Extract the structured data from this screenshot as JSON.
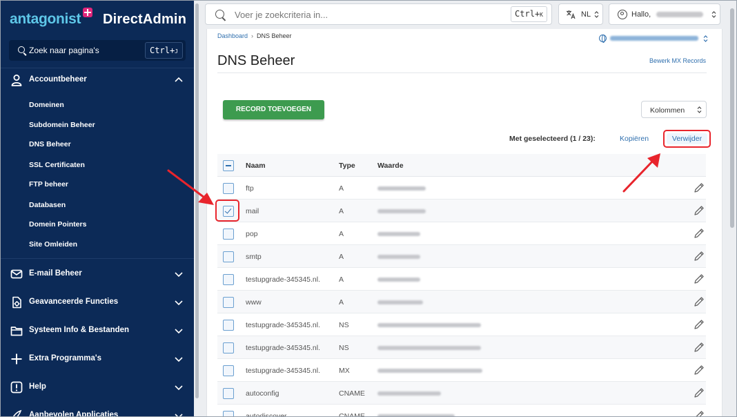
{
  "brand": {
    "logo_text": "antagonist",
    "product": "DirectAdmin"
  },
  "sidebar": {
    "search_placeholder": "Zoek naar pagina's",
    "search_shortcut": "Ctrl+",
    "search_shortcut_key": "J",
    "sections": [
      {
        "label": "Accountbeheer",
        "icon": "user-icon",
        "expanded": true
      },
      {
        "label": "E-mail Beheer",
        "icon": "mail-icon",
        "expanded": false
      },
      {
        "label": "Geavanceerde Functies",
        "icon": "advanced-icon",
        "expanded": false
      },
      {
        "label": "Systeem Info & Bestanden",
        "icon": "folder-icon",
        "expanded": false
      },
      {
        "label": "Extra Programma's",
        "icon": "plus-icon",
        "expanded": false
      },
      {
        "label": "Help",
        "icon": "help-icon",
        "expanded": false
      },
      {
        "label": "Aanbevolen Applicaties",
        "icon": "apps-icon",
        "expanded": false
      }
    ],
    "items": [
      {
        "label": "Domeinen"
      },
      {
        "label": "Subdomein Beheer"
      },
      {
        "label": "DNS Beheer"
      },
      {
        "label": "SSL Certificaten"
      },
      {
        "label": "FTP beheer"
      },
      {
        "label": "Databasen"
      },
      {
        "label": "Domein Pointers"
      },
      {
        "label": "Site Omleiden"
      }
    ]
  },
  "topbar": {
    "search_placeholder": "Voer je zoekcriteria in...",
    "search_shortcut": "Ctrl+",
    "search_shortcut_key": "K",
    "language": "NL",
    "user_greeting": "Hallo,"
  },
  "breadcrumb": {
    "home": "Dashboard",
    "current": "DNS Beheer"
  },
  "page": {
    "title": "DNS Beheer",
    "mx_link": "Bewerk MX Records",
    "add_button": "RECORD TOEVOEGEN",
    "columns_button": "Kolommen",
    "selected_info": "Met geselecteerd (1 / 23):",
    "copy_button": "Kopiëren",
    "delete_button": "Verwijder"
  },
  "table": {
    "headers": {
      "name": "Naam",
      "type": "Type",
      "value": "Waarde"
    },
    "rows": [
      {
        "name": "ftp",
        "type": "A",
        "checked": false
      },
      {
        "name": "mail",
        "type": "A",
        "checked": true
      },
      {
        "name": "pop",
        "type": "A",
        "checked": false
      },
      {
        "name": "smtp",
        "type": "A",
        "checked": false
      },
      {
        "name": "testupgrade-345345.nl.",
        "type": "A",
        "checked": false
      },
      {
        "name": "www",
        "type": "A",
        "checked": false
      },
      {
        "name": "testupgrade-345345.nl.",
        "type": "NS",
        "checked": false
      },
      {
        "name": "testupgrade-345345.nl.",
        "type": "NS",
        "checked": false
      },
      {
        "name": "testupgrade-345345.nl.",
        "type": "MX",
        "checked": false
      },
      {
        "name": "autoconfig",
        "type": "CNAME",
        "checked": false
      },
      {
        "name": "autodiscover",
        "type": "CNAME",
        "checked": false
      }
    ]
  },
  "colors": {
    "sidebar_bg": "#0c2a57",
    "accent_blue": "#2f6fae",
    "add_green": "#3d9b4f",
    "highlight_red": "#e8242c",
    "brand_cyan": "#5ec7e8",
    "brand_pink": "#e0267a"
  }
}
